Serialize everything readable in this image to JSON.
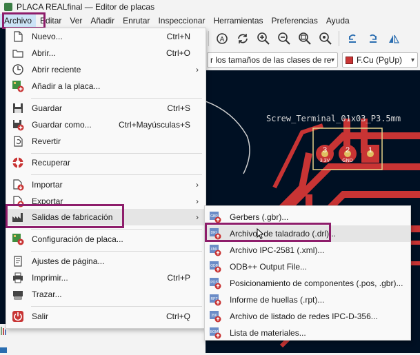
{
  "window": {
    "title": "PLACA REALfinal — Editor de placas"
  },
  "menubar": {
    "items": [
      "Archivo",
      "Editar",
      "Ver",
      "Añadir",
      "Enrutar",
      "Inspeccionar",
      "Herramientas",
      "Preferencias",
      "Ayuda"
    ]
  },
  "toolbar2": {
    "track_width": "r los tamaños de las clases de red",
    "layer": "F.Cu (PgUp)",
    "layer_color": "#c83434"
  },
  "canvas": {
    "footprint_ref": "Screw_Terminal_01x03_P3.5mm",
    "pads": [
      {
        "num": "3",
        "net": "3.3V"
      },
      {
        "num": "2",
        "net": "GND"
      },
      {
        "num": "1",
        "net": ""
      }
    ],
    "copper_color": "#c83434",
    "background_color": "#001023"
  },
  "menu": {
    "items": [
      {
        "label": "Nuevo...",
        "shortcut": "Ctrl+N",
        "icon": "new-file-icon"
      },
      {
        "label": "Abrir...",
        "shortcut": "Ctrl+O",
        "icon": "folder-open-icon"
      },
      {
        "label": "Abrir reciente",
        "shortcut": "",
        "icon": "clock-icon",
        "submenu": true
      },
      {
        "label": "Añadir a la placa...",
        "shortcut": "",
        "icon": "add-to-board-icon"
      },
      {
        "label": "Guardar",
        "shortcut": "Ctrl+S",
        "icon": "save-icon"
      },
      {
        "label": "Guardar como...",
        "shortcut": "Ctrl+Mayúsculas+S",
        "icon": "save-as-icon"
      },
      {
        "label": "Revertir",
        "shortcut": "",
        "icon": "revert-icon"
      },
      {
        "label": "Recuperar",
        "shortcut": "",
        "icon": "rescue-icon"
      },
      {
        "label": "Importar",
        "shortcut": "",
        "icon": "import-icon",
        "submenu": true
      },
      {
        "label": "Exportar",
        "shortcut": "",
        "icon": "export-icon",
        "submenu": true
      },
      {
        "label": "Salidas de fabricación",
        "shortcut": "",
        "icon": "fabrication-icon",
        "submenu": true
      },
      {
        "label": "Configuración de placa...",
        "shortcut": "",
        "icon": "board-setup-icon"
      },
      {
        "label": "Ajustes de página...",
        "shortcut": "",
        "icon": "page-settings-icon"
      },
      {
        "label": "Imprimir...",
        "shortcut": "Ctrl+P",
        "icon": "print-icon"
      },
      {
        "label": "Trazar...",
        "shortcut": "",
        "icon": "plot-icon"
      },
      {
        "label": "Salir",
        "shortcut": "Ctrl+Q",
        "icon": "exit-icon"
      }
    ],
    "submenu_arrow": "›"
  },
  "submenu": {
    "items": [
      {
        "label": "Gerbers (.gbr)...",
        "icon": "gerber-file-icon",
        "tag": "GBR"
      },
      {
        "label": "Archivos de taladrado (.drl)...",
        "icon": "drill-file-icon",
        "tag": "DRL"
      },
      {
        "label": "Archivo IPC-2581 (.xml)...",
        "icon": "ipc2581-file-icon",
        "tag": "XML"
      },
      {
        "label": "ODB++ Output File...",
        "icon": "odb-file-icon",
        "tag": "ODB"
      },
      {
        "label": "Posicionamiento de componentes (.pos, .gbr)...",
        "icon": "position-file-icon",
        "tag": "POS"
      },
      {
        "label": "Informe de huellas (.rpt)...",
        "icon": "report-file-icon",
        "tag": "RPT"
      },
      {
        "label": "Archivo de listado de redes IPC-D-356...",
        "icon": "netlist-file-icon",
        "tag": "356"
      },
      {
        "label": "Lista de materiales...",
        "icon": "bom-file-icon",
        "tag": "BOM"
      }
    ]
  }
}
